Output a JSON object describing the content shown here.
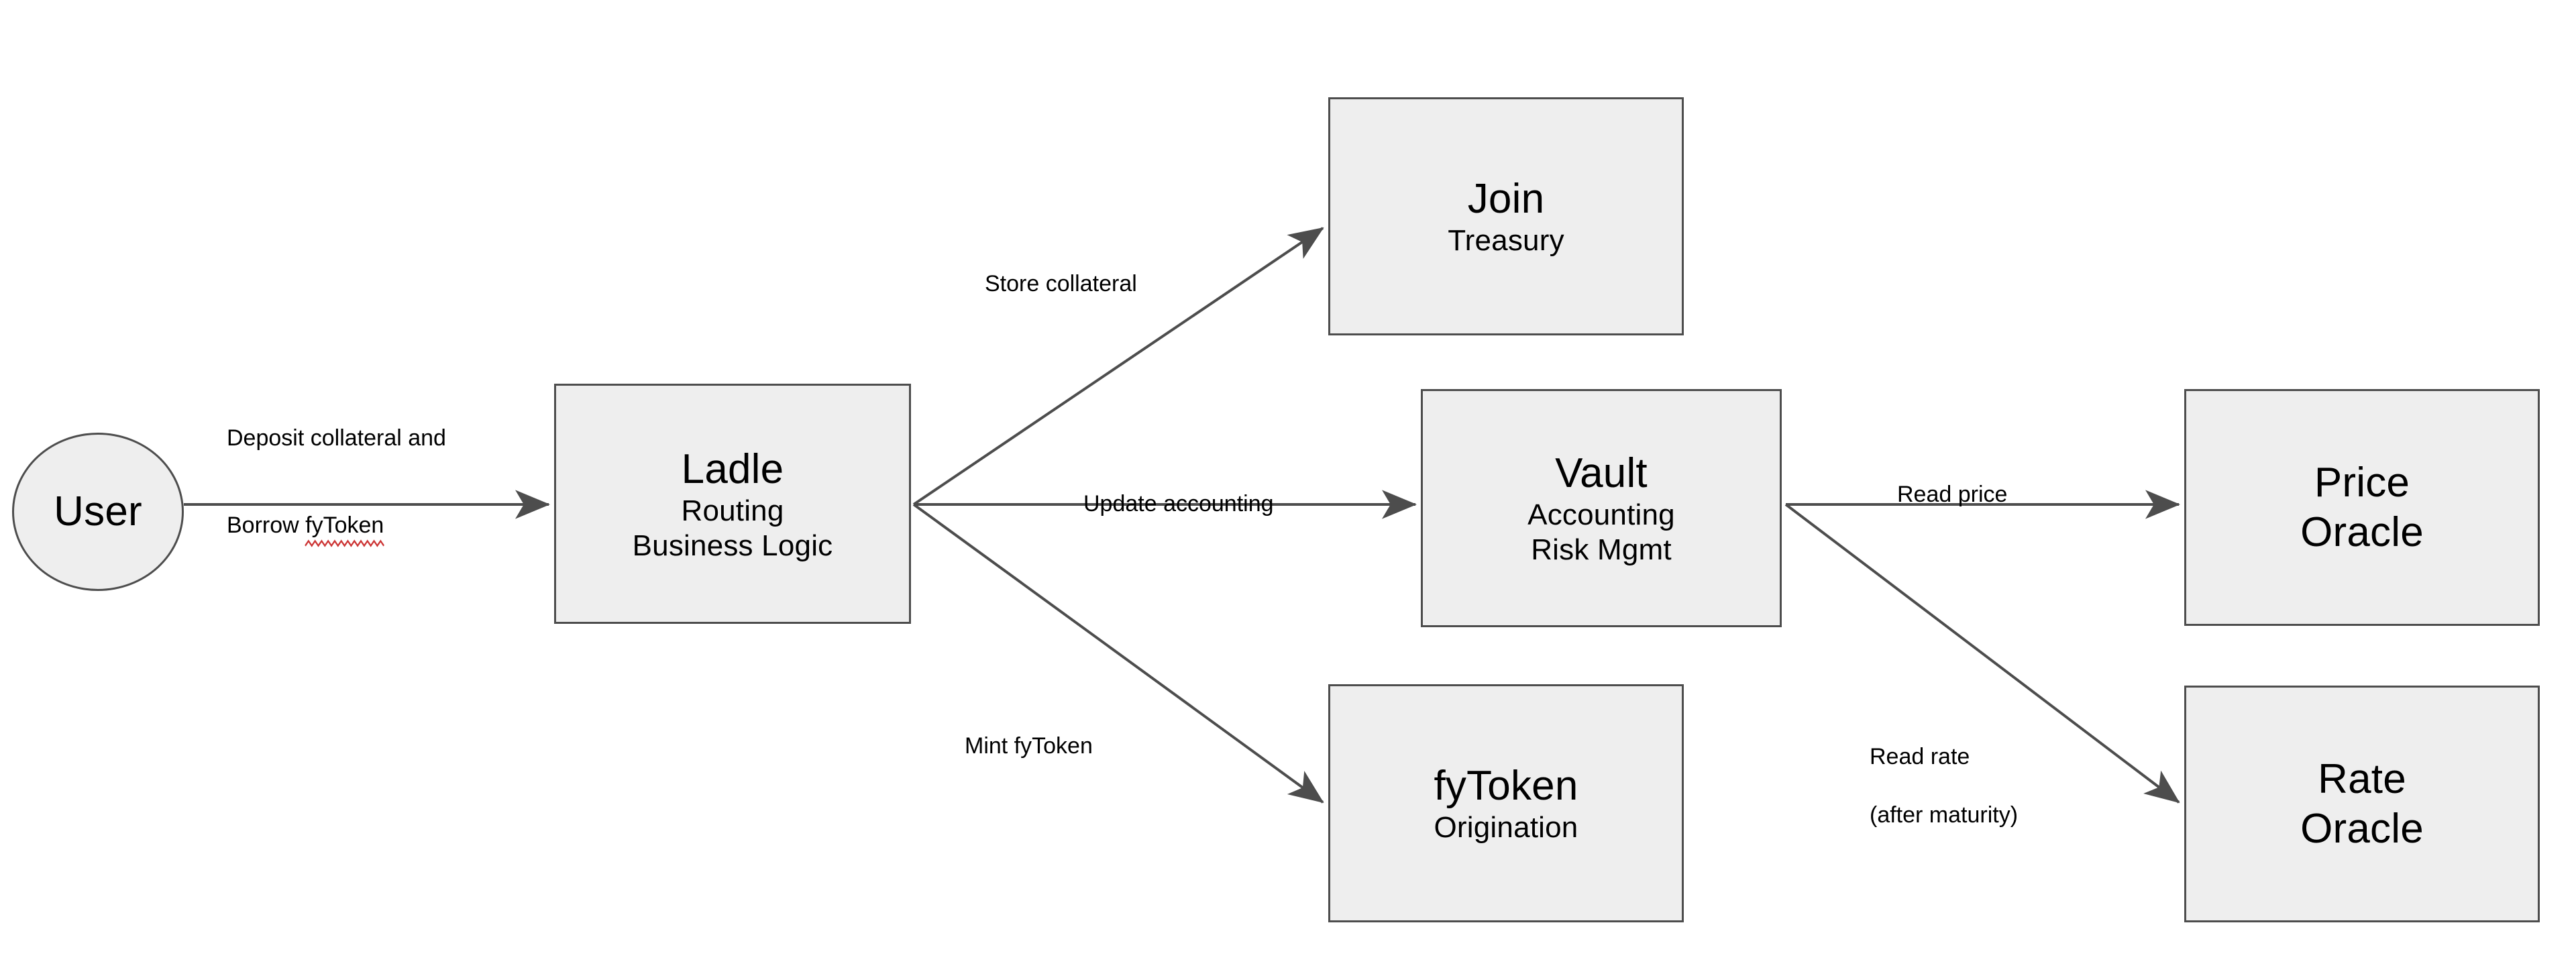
{
  "diagram": {
    "type": "architecture-flow-diagram",
    "background_color": "#ffffff",
    "node_fill": "#eeeeee",
    "node_stroke": "#4d4d4d",
    "edge_color": "#4d4d4d",
    "spellcheck_underline_color": "#cc3333"
  },
  "nodes": {
    "user": {
      "shape": "ellipse",
      "title": "User",
      "subtitle": ""
    },
    "ladle": {
      "shape": "rect",
      "title": "Ladle",
      "sub1": "Routing",
      "sub2": "Business Logic"
    },
    "join": {
      "shape": "rect",
      "title": "Join",
      "sub1": "Treasury"
    },
    "vault": {
      "shape": "rect",
      "title": "Vault",
      "sub1": "Accounting",
      "sub2": "Risk Mgmt"
    },
    "fytoken": {
      "shape": "rect",
      "title": "fyToken",
      "sub1": "Origination"
    },
    "price_oracle": {
      "shape": "rect",
      "line1": "Price",
      "line2": "Oracle"
    },
    "rate_oracle": {
      "shape": "rect",
      "line1": "Rate",
      "line2": "Oracle"
    }
  },
  "edges": {
    "user_to_ladle": {
      "label_line1": "Deposit collateral and",
      "label_line2_prefix": "Borrow ",
      "label_line2_misspelled": "fyToken",
      "from": "user",
      "to": "ladle"
    },
    "ladle_to_join": {
      "label": "Store collateral",
      "from": "ladle",
      "to": "join"
    },
    "ladle_to_vault": {
      "label": "Update accounting",
      "from": "ladle",
      "to": "vault"
    },
    "ladle_to_fytoken": {
      "label": "Mint fyToken",
      "from": "ladle",
      "to": "fytoken"
    },
    "vault_to_price_oracle": {
      "label": "Read price",
      "from": "vault",
      "to": "price_oracle"
    },
    "vault_to_rate_oracle": {
      "label_line1": "Read rate",
      "label_line2": "(after maturity)",
      "from": "vault",
      "to": "rate_oracle"
    }
  }
}
